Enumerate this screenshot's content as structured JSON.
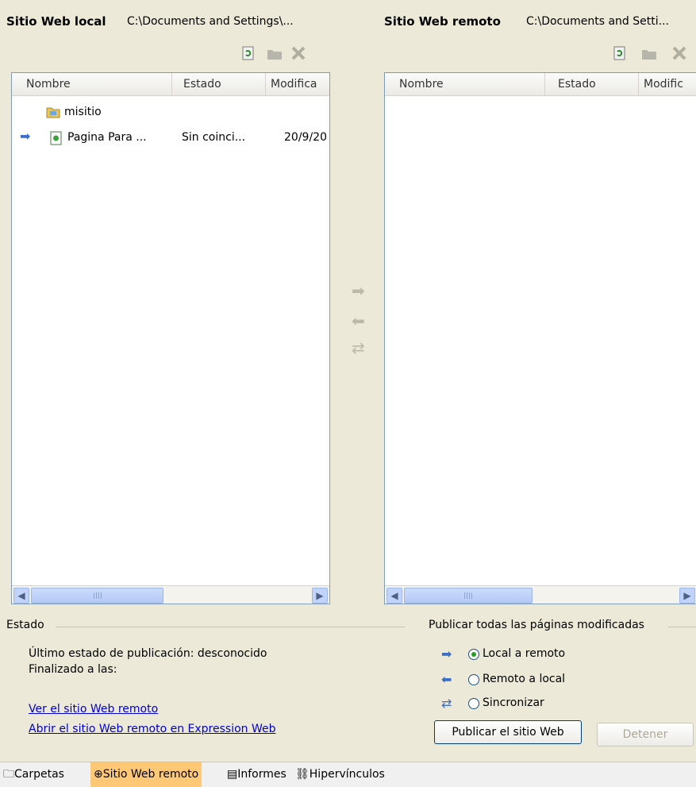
{
  "local": {
    "title": "Sitio Web local",
    "path": "C:\\Documents and Settings\\...",
    "columns": [
      "Nombre",
      "Estado",
      "Modifica"
    ],
    "rows": [
      {
        "name": "misitio",
        "status": "",
        "modified": "",
        "icon": "folder-icon"
      },
      {
        "name": "Pagina Para ...",
        "status": "Sin coinci...",
        "modified": "20/9/20",
        "icon": "html-page-icon",
        "marker": "right-arrow-icon"
      }
    ]
  },
  "remote": {
    "title": "Sitio Web remoto",
    "path": "C:\\Documents and Setti...",
    "columns": [
      "Nombre",
      "Estado",
      "Modific"
    ]
  },
  "status": {
    "heading": "Estado",
    "last_status": "Último estado de publicación: desconocido",
    "finished": "Finalizado a las:",
    "link_view": "Ver el sitio Web remoto",
    "link_open": "Abrir el sitio Web remoto en Expression Web"
  },
  "publish": {
    "heading": "Publicar todas las páginas modificadas",
    "options": [
      {
        "label": "Local a remoto",
        "selected": true
      },
      {
        "label": "Remoto a local",
        "selected": false
      },
      {
        "label": "Sincronizar",
        "selected": false
      }
    ],
    "publish_button": "Publicar el sitio Web",
    "stop_button": "Detener"
  },
  "tabs": [
    {
      "label": "Carpetas",
      "active": false
    },
    {
      "label": "Sitio Web remoto",
      "active": true
    },
    {
      "label": "Informes",
      "active": false
    },
    {
      "label": "Hipervínculos",
      "active": false
    }
  ],
  "colors": {
    "accent": "#ffc877",
    "link": "#0000cc",
    "pane_border": "#7f9db9"
  }
}
